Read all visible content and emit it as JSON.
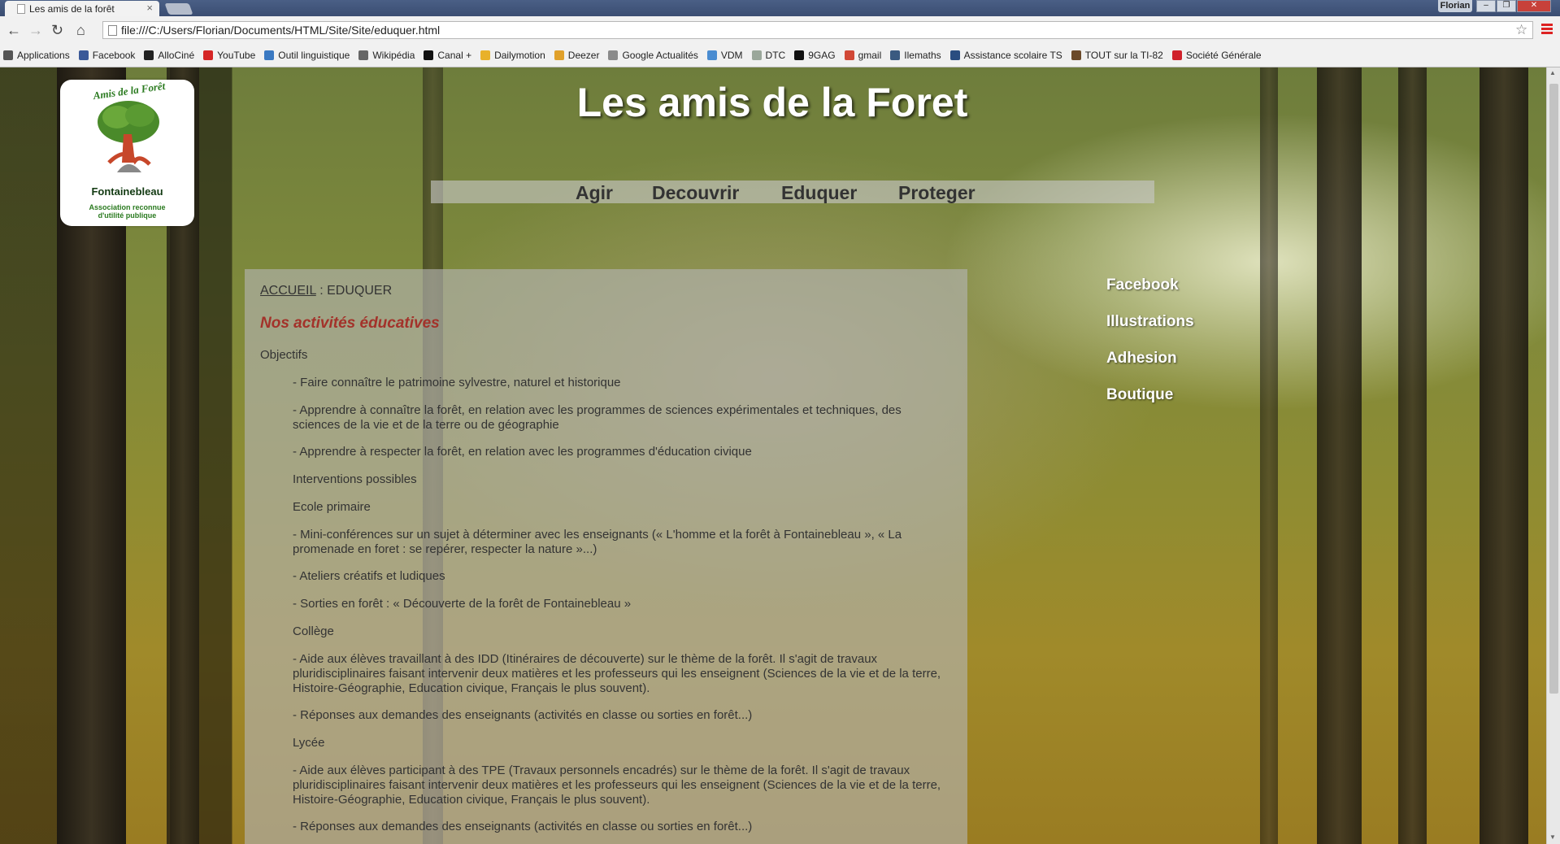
{
  "browser": {
    "tab_title": "Les amis de la forêt",
    "user_name": "Florian",
    "url": "file:///C:/Users/Florian/Documents/HTML/Site/Site/eduquer.html",
    "bookmarks": [
      {
        "label": "Applications",
        "icon": "apps-icon",
        "color": "#555555"
      },
      {
        "label": "Facebook",
        "icon": "facebook-icon",
        "color": "#3b5998"
      },
      {
        "label": "AlloCiné",
        "icon": "allocine-icon",
        "color": "#222222"
      },
      {
        "label": "YouTube",
        "icon": "youtube-icon",
        "color": "#d52525"
      },
      {
        "label": "Outil linguistique",
        "icon": "globe-icon",
        "color": "#3a79c2"
      },
      {
        "label": "Wikipédia",
        "icon": "wikipedia-icon",
        "color": "#666666"
      },
      {
        "label": "Canal +",
        "icon": "canal-plus-icon",
        "color": "#111111"
      },
      {
        "label": "Dailymotion",
        "icon": "dailymotion-icon",
        "color": "#e8b12a"
      },
      {
        "label": "Deezer",
        "icon": "deezer-icon",
        "color": "#e0a02a"
      },
      {
        "label": "Google Actualités",
        "icon": "news-icon",
        "color": "#8a8a8a"
      },
      {
        "label": "VDM",
        "icon": "vdm-icon",
        "color": "#4a8cd1"
      },
      {
        "label": "DTC",
        "icon": "document-icon",
        "color": "#9aa79a"
      },
      {
        "label": "9GAG",
        "icon": "9gag-icon",
        "color": "#111111"
      },
      {
        "label": "gmail",
        "icon": "gmail-icon",
        "color": "#d14836"
      },
      {
        "label": "Ilemaths",
        "icon": "bookmark-icon",
        "color": "#3a5a80"
      },
      {
        "label": "Assistance scolaire TS",
        "icon": "asp-icon",
        "color": "#2a4d80"
      },
      {
        "label": "TOUT sur la TI-82",
        "icon": "calculator-icon",
        "color": "#6b4a2a"
      },
      {
        "label": "Société Générale",
        "icon": "bank-icon",
        "color": "#d0212b"
      }
    ]
  },
  "site": {
    "logo": {
      "arc_text": "Amis de la Forêt",
      "name": "Fontainebleau",
      "tagline": "Association reconnue d'utilité publique"
    },
    "title": "Les amis de la Foret",
    "nav": [
      "Agir",
      "Decouvrir",
      "Eduquer",
      "Proteger"
    ],
    "side_links": [
      "Facebook",
      "Illustrations",
      "Adhesion",
      "Boutique"
    ]
  },
  "content": {
    "breadcrumb_home": "ACCUEIL",
    "breadcrumb_sep": " : ",
    "breadcrumb_current": "EDUQUER",
    "section_title": "Nos activités éducatives",
    "objectifs_label": "Objectifs",
    "paragraphs": [
      "- Faire connaître le patrimoine sylvestre, naturel et historique",
      "- Apprendre à connaître la forêt, en relation avec les programmes de sciences expérimentales et techniques, des sciences de la vie et de la terre ou de géographie",
      "- Apprendre à respecter la forêt, en relation avec les programmes d'éducation civique",
      "Interventions possibles",
      "Ecole primaire",
      "- Mini-conférences sur un sujet à déterminer avec les enseignants (« L'homme et la forêt à Fontainebleau », « La promenade en foret : se repérer, respecter la nature »...)",
      "- Ateliers créatifs et ludiques",
      "- Sorties en forêt : « Découverte de la forêt de Fontainebleau »",
      "Collège",
      "- Aide aux élèves travaillant à des IDD (Itinéraires de découverte) sur le thème de la forêt. Il s'agit de travaux pluridisciplinaires faisant intervenir deux matières et les professeurs qui les enseignent (Sciences de la vie et de la terre, Histoire-Géographie, Education civique, Français le plus souvent).",
      "- Réponses aux demandes des enseignants (activités en classe ou sorties en forêt...)",
      "Lycée",
      "- Aide aux élèves participant à des TPE (Travaux personnels encadrés) sur le thème de la forêt. Il s'agit de travaux pluridisciplinaires faisant intervenir deux matières et les professeurs qui les enseignent (Sciences de la vie et de la terre, Histoire-Géographie, Education civique, Français le plus souvent).",
      "- Réponses aux demandes des enseignants (activités en classe ou sorties en forêt...)"
    ]
  }
}
